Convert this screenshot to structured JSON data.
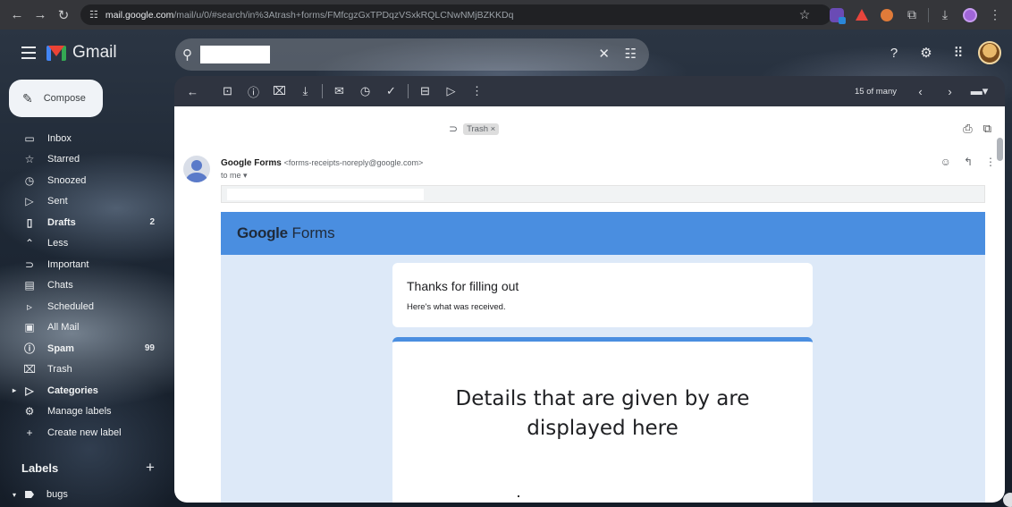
{
  "browser": {
    "back_icon": "arrow-left",
    "forward_icon": "arrow-right",
    "reload_icon": "reload",
    "url_host": "mail.google.com",
    "url_path": "/mail/u/0/#search/in%3Atrash+forms/FMfcgzGxTPDqzVSxkRQLCNwNMjBZKKDq"
  },
  "gmail": {
    "logo_text": "Gmail",
    "search": {
      "value": "",
      "placeholder": ""
    },
    "compose_label": "Compose"
  },
  "sidebar": {
    "items": [
      {
        "label": "Inbox",
        "icon": "inbox-icon",
        "bold": false
      },
      {
        "label": "Starred",
        "icon": "star-icon",
        "bold": false
      },
      {
        "label": "Snoozed",
        "icon": "clock-icon",
        "bold": false
      },
      {
        "label": "Sent",
        "icon": "send-icon",
        "bold": false
      },
      {
        "label": "Drafts",
        "icon": "draft-icon",
        "bold": true,
        "count": "2"
      },
      {
        "label": "Less",
        "icon": "chevron-up-icon",
        "bold": false
      },
      {
        "label": "Important",
        "icon": "important-icon",
        "bold": false
      },
      {
        "label": "Chats",
        "icon": "chat-icon",
        "bold": false
      },
      {
        "label": "Scheduled",
        "icon": "scheduled-icon",
        "bold": false
      },
      {
        "label": "All Mail",
        "icon": "all-mail-icon",
        "bold": false
      },
      {
        "label": "Spam",
        "icon": "spam-icon",
        "bold": true,
        "count": "99"
      },
      {
        "label": "Trash",
        "icon": "trash-icon",
        "bold": false
      },
      {
        "label": "Categories",
        "icon": "label-outline-icon",
        "bold": true
      },
      {
        "label": "Manage labels",
        "icon": "gear-icon",
        "bold": false
      },
      {
        "label": "Create new label",
        "icon": "plus-icon",
        "bold": false
      }
    ],
    "labels_header": "Labels",
    "labels": [
      {
        "label": "bugs"
      }
    ]
  },
  "toolbar": {
    "count_text": "15 of many"
  },
  "message": {
    "label_chip": "Trash ×",
    "sender_name": "Google Forms",
    "sender_email": "<forms-receipts-noreply@google.com>",
    "to_line": "to me ▾",
    "forms_logo_google": "Google",
    "forms_logo_forms": "Forms",
    "card_title": "Thanks for filling out",
    "card_subtitle": "Here's what was received.",
    "details_line1": "Details that are given by are",
    "details_line2": "displayed here"
  },
  "colors": {
    "forms_blue": "#4a8ee0",
    "forms_bg": "#dde9f8",
    "toolbar_bg": "#2f3440"
  }
}
